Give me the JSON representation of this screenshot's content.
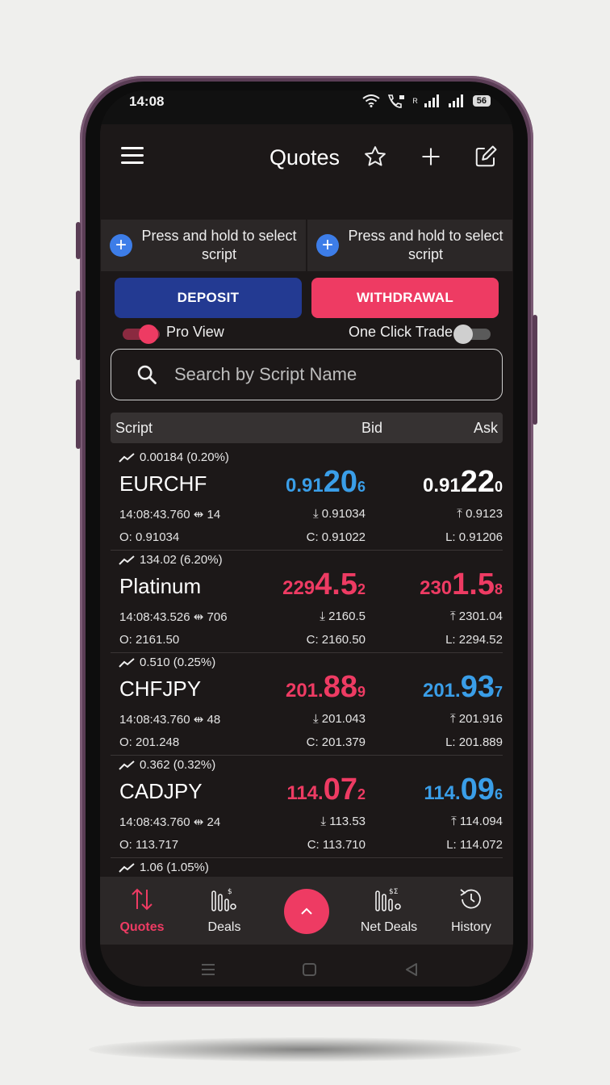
{
  "status_bar": {
    "time": "14:08",
    "signal_label": "R",
    "battery": "56"
  },
  "header": {
    "title": "Quotes"
  },
  "quick_select": [
    {
      "label": "Press and hold to select script"
    },
    {
      "label": "Press and hold to select script"
    }
  ],
  "actions": {
    "deposit": "DEPOSIT",
    "withdrawal": "WITHDRAWAL"
  },
  "toggles": {
    "pro_view": "Pro View",
    "one_click": "One Click Trade"
  },
  "search": {
    "placeholder": "Search by Script Name"
  },
  "table_header": {
    "script": "Script",
    "bid": "Bid",
    "ask": "Ask"
  },
  "quotes": [
    {
      "change": "0.00184 (0.20%)",
      "symbol": "EURCHF",
      "bid_prefix": "0.91",
      "bid_main": "20",
      "bid_sup": "6",
      "ask_prefix": "0.91",
      "ask_main": "22",
      "ask_sup": "0",
      "time": "14:08:43.760",
      "spread": "14",
      "low": "0.91034",
      "high": "0.9123",
      "open": "O: 0.91034",
      "close": "C: 0.91022",
      "last": "L: 0.91206"
    },
    {
      "change": "134.02 (6.20%)",
      "symbol": "Platinum",
      "bid_prefix": "229",
      "bid_main": "4.5",
      "bid_sup": "2",
      "ask_prefix": "230",
      "ask_main": "1.5",
      "ask_sup": "8",
      "time": "14:08:43.526",
      "spread": "706",
      "low": "2160.5",
      "high": "2301.04",
      "open": "O: 2161.50",
      "close": "C: 2160.50",
      "last": "L: 2294.52"
    },
    {
      "change": "0.510 (0.25%)",
      "symbol": "CHFJPY",
      "bid_prefix": "201.",
      "bid_main": "88",
      "bid_sup": "9",
      "ask_prefix": "201.",
      "ask_main": "93",
      "ask_sup": "7",
      "time": "14:08:43.760",
      "spread": "48",
      "low": "201.043",
      "high": "201.916",
      "open": "O: 201.248",
      "close": "C: 201.379",
      "last": "L: 201.889"
    },
    {
      "change": "0.362 (0.32%)",
      "symbol": "CADJPY",
      "bid_prefix": "114.",
      "bid_main": "07",
      "bid_sup": "2",
      "ask_prefix": "114.",
      "ask_main": "09",
      "ask_sup": "6",
      "time": "14:08:43.760",
      "spread": "24",
      "low": "113.53",
      "high": "114.094",
      "open": "O: 113.717",
      "close": "C: 113.710",
      "last": "L: 114.072"
    },
    {
      "change": "1.06 (1.05%)"
    }
  ],
  "bottom_nav": {
    "quotes": "Quotes",
    "deals": "Deals",
    "net_deals": "Net Deals",
    "history": "History"
  },
  "colors": {
    "accent": "#ee3b63",
    "deposit": "#233a92",
    "bid_up": "#3a9ee8",
    "bid_down": "#ee3b63"
  }
}
